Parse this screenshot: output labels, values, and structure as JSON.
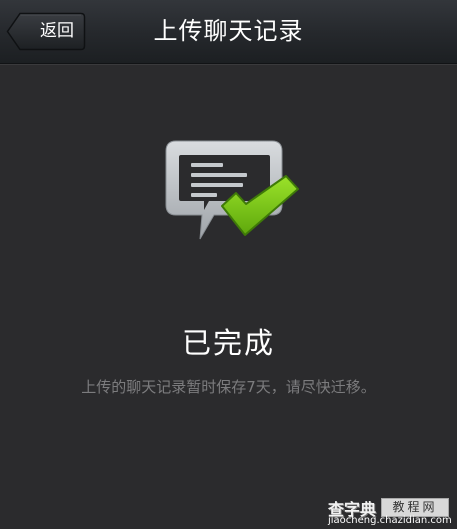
{
  "header": {
    "back_label": "返回",
    "title": "上传聊天记录"
  },
  "status": {
    "icon": "chat-record-check-icon",
    "title": "已完成",
    "description": "上传的聊天记录暂时保存7天，请尽快迁移。"
  },
  "watermark": {
    "brand": "查字典",
    "badge": "教程网",
    "domain": "jiaocheng.chazidian.com"
  },
  "colors": {
    "background": "#2b2b2d",
    "nav_bar": "#26292d",
    "check_green": "#7cc417",
    "icon_gray": "#c5c9cd",
    "description_text": "#7c7c7e"
  }
}
